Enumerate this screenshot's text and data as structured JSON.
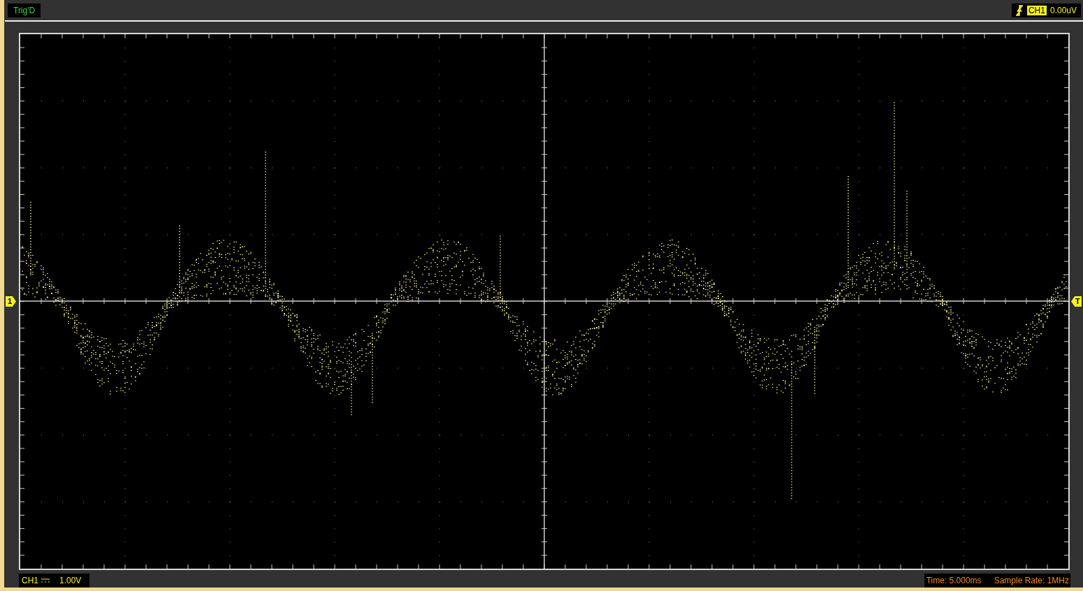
{
  "status": {
    "text": "Trig'D"
  },
  "trigger": {
    "rising_edge": true,
    "channel": "CH1",
    "level": "0.00uV"
  },
  "markers": {
    "channel": "1",
    "trigger": "T"
  },
  "footer": {
    "channel": "CH1",
    "dc_coupling": true,
    "volts": "1.00V",
    "time": "Time: 5.000ms",
    "sample_rate": "Sample Rate: 1MHz"
  }
}
